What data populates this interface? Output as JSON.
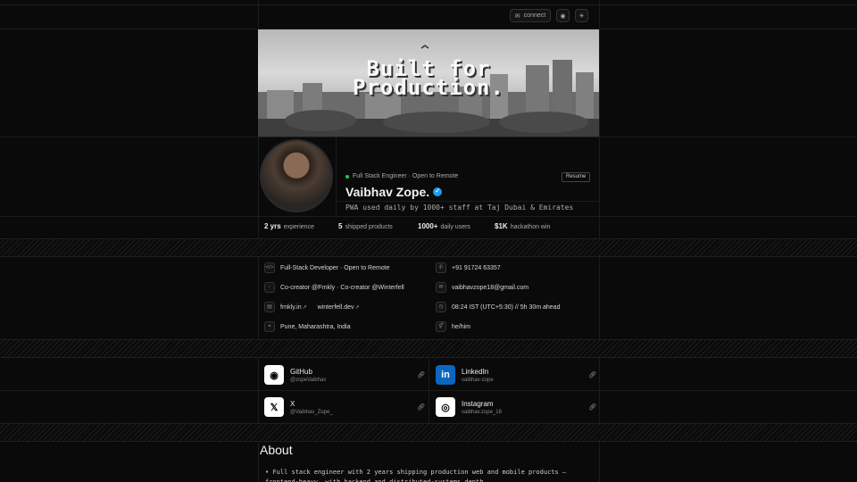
{
  "header": {
    "connect_label": "connect",
    "github_icon": "github-icon",
    "theme_icon": "sun-icon"
  },
  "banner": {
    "line1": "Built for",
    "line2": "Production."
  },
  "profile": {
    "status": "Full Stack Engineer · Open to Remote",
    "resume_label": "Resume",
    "name": "Vaibhav Zope.",
    "tagline": "PWA used daily by 1000+ staff at Taj Dubai & Emirates"
  },
  "stats": [
    {
      "value": "2 yrs",
      "label": "experience"
    },
    {
      "value": "5",
      "label": "shipped products"
    },
    {
      "value": "1000+",
      "label": "daily users"
    },
    {
      "value": "$1K",
      "label": "hackathon win"
    }
  ],
  "info": {
    "role": "Full-Stack Developer · Open to Remote",
    "company": "Co-creator @Frnkly · Co-creator @Winterfell",
    "site1": "frnkly.in",
    "site2": "winterfell.dev",
    "location": "Pune, Maharashtra, India",
    "phone": "+91 91724 63357",
    "email": "vaibhavzope18@gmail.com",
    "time": "08:24 IST (UTC+5:30) // 5h 30m ahead",
    "pronouns": "he/him"
  },
  "socials": [
    {
      "name": "GitHub",
      "handle": "@zopeVaibhav",
      "color": "#ffffff"
    },
    {
      "name": "LinkedIn",
      "handle": "vaibhav-zope",
      "color": "#0a66c2"
    },
    {
      "name": "X",
      "handle": "@Vaibhav_Zope_",
      "color": "#ffffff"
    },
    {
      "name": "Instagram",
      "handle": "vaibhav.zope_18",
      "color": "#ffffff"
    }
  ],
  "about": {
    "title": "About",
    "bullet1": "• Full stack engineer with 2 years shipping production web and mobile products — frontend-heavy, with backend and distributed-systems depth."
  }
}
